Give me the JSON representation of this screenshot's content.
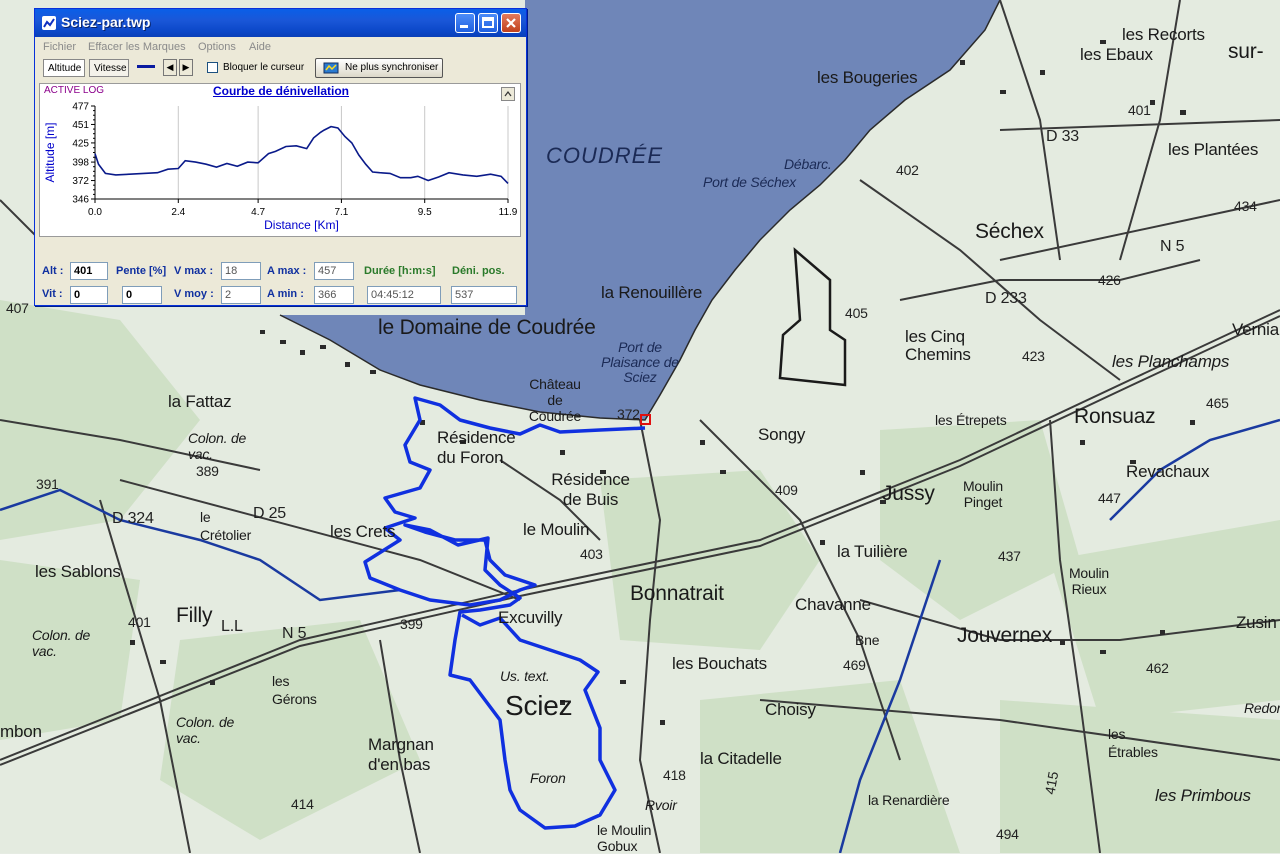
{
  "window": {
    "title": "Sciez-par.twp",
    "controls": {
      "minimize": "minimize",
      "maximize": "maximize",
      "close": "close"
    }
  },
  "menu": [
    "Fichier",
    "Effacer les Marques",
    "Options",
    "Aide"
  ],
  "toolbar": {
    "tab_altitude": "Altitude",
    "tab_vitesse": "Vitesse",
    "prev": "◀",
    "next": "▶",
    "lock_label": "Bloquer le curseur",
    "lock_checked": false,
    "sync_label": "Ne plus synchroniser"
  },
  "chart_data": {
    "type": "line",
    "active_log": "ACTIVE LOG",
    "title": "Courbe de dénivellation",
    "xlabel": "Distance [Km]",
    "ylabel": "Altitude [m]",
    "xlim": [
      0.0,
      11.9
    ],
    "ylim": [
      346,
      477
    ],
    "x_ticks": [
      "0.0",
      "2.4",
      "4.7",
      "7.1",
      "9.5",
      "11.9"
    ],
    "y_ticks": [
      "477",
      "451",
      "425",
      "398",
      "372",
      "346"
    ],
    "grid": true,
    "line_color": "#0a1a8a",
    "series": [
      {
        "x": [
          0.0,
          0.1,
          0.3,
          0.6,
          1.0,
          1.4,
          1.8,
          2.1,
          2.4,
          2.6,
          2.9,
          3.2,
          3.5,
          3.8,
          4.1,
          4.4,
          4.7,
          5.0,
          5.2,
          5.5,
          5.8,
          6.1,
          6.3,
          6.5,
          6.6,
          6.8,
          7.0,
          7.2,
          7.4,
          7.6,
          7.8,
          8.0,
          8.2,
          8.5,
          8.8,
          9.1,
          9.3,
          9.6,
          9.9,
          10.2,
          10.6,
          11.0,
          11.4,
          11.7,
          11.9
        ],
        "y": [
          410,
          395,
          382,
          380,
          381,
          382,
          383,
          388,
          389,
          400,
          398,
          395,
          391,
          396,
          392,
          398,
          397,
          410,
          413,
          420,
          421,
          417,
          432,
          440,
          443,
          448,
          446,
          434,
          425,
          408,
          395,
          384,
          383,
          382,
          376,
          376,
          378,
          372,
          377,
          383,
          380,
          378,
          381,
          378,
          368
        ]
      }
    ]
  },
  "fields": {
    "alt_label": "Alt :",
    "alt_value": "401",
    "vit_label": "Vit :",
    "vit_value": "0",
    "pente_label": "Pente [%]",
    "pente_value": "0",
    "vmax_label": "V max :",
    "vmax_value": "18",
    "vmoy_label": "V moy :",
    "vmoy_value": "2",
    "amax_label": "A max :",
    "amax_value": "457",
    "amin_label": "A min :",
    "amin_value": "366",
    "duree_label": "Durée [h:m:s]",
    "duree_value": "04:45:12",
    "deni_label": "Déni. pos.",
    "deni_value": "537"
  },
  "map": {
    "lake_color": "#6f86b8",
    "track_color": "#1030e0",
    "labels": {
      "coudree": "COUDRÉE",
      "bougeries": "les Bougeries",
      "recorts": "les Recorts",
      "ebaux": "les Ebaux",
      "sur": "sur-",
      "plantees": "les Plantées",
      "sechex": "Séchex",
      "debarc": "Débarc.",
      "port_sechex": "Port de Séchex",
      "renouillere": "la Renouillère",
      "domaine": "le Domaine de Coudrée",
      "cinq_chemins": "les Cinq Chemins",
      "planchamps": "les Planchamps",
      "ronsuaz": "Ronsuaz",
      "verniaz": "Vernia",
      "revachaux": "Revachaux",
      "etrepets": "les Étrepets",
      "port_plaisance": "Port de Plaisance de Sciez",
      "chateau": "Château de Coudrée",
      "songy": "Songy",
      "fattaz": "la Fattaz",
      "colon1": "Colon. de vac.",
      "residence_foron": "Résidence du Foron",
      "residence_buis": "Résidence de Buis",
      "jussy": "Jussy",
      "moulin_pinget": "Moulin Pinget",
      "cretolier": "le Crétolier",
      "les_crets": "les Crets",
      "le_moulin": "le Moulin",
      "tuiliere": "la Tuilière",
      "sablons": "les Sablons",
      "bonnatrait": "Bonnatrait",
      "chavanne": "Chavanne",
      "moulin_rieux": "Moulin Rieux",
      "filly": "Filly",
      "excuvilly": "Excuvilly",
      "jouvernex": "Jouvernex",
      "zusin": "Zusin",
      "colon2": "Colon. de vac.",
      "gerons": "les Gérons",
      "bouchats": "les Bouchats",
      "sciez": "Sciez",
      "choisy": "Choisy",
      "etrables": "les Étrables",
      "colon3": "Colon. de vac.",
      "margnan": "Margnan d'en bas",
      "citadelle": "la Citadelle",
      "renardiere": "la Renardière",
      "primbous": "les Primbous",
      "moulin_gobux": "le Moulin Gobux",
      "foron": "Foron",
      "us_text": "Us. text.",
      "bne": "Bne",
      "rvoir": "Rvoir",
      "mbon": "mbon",
      "redon": "Redon",
      "d33": "D 33",
      "n5": "N 5",
      "d25": "D 25",
      "d324": "D 324",
      "n5b": "N 5",
      "d233": "D 233",
      "ll": "L.L",
      "n401": "401",
      "n402": "402",
      "n434": "434",
      "n426": "426",
      "n405": "405",
      "n423": "423",
      "n465": "465",
      "n447": "447",
      "n437": "437",
      "n389": "389",
      "n391": "391",
      "n407": "407",
      "n409": "409",
      "n403": "403",
      "n399": "399",
      "n401b": "401",
      "n469": "469",
      "n462": "462",
      "n414": "414",
      "n418": "418",
      "n494": "494",
      "n372": "372",
      "n415": "415"
    }
  }
}
